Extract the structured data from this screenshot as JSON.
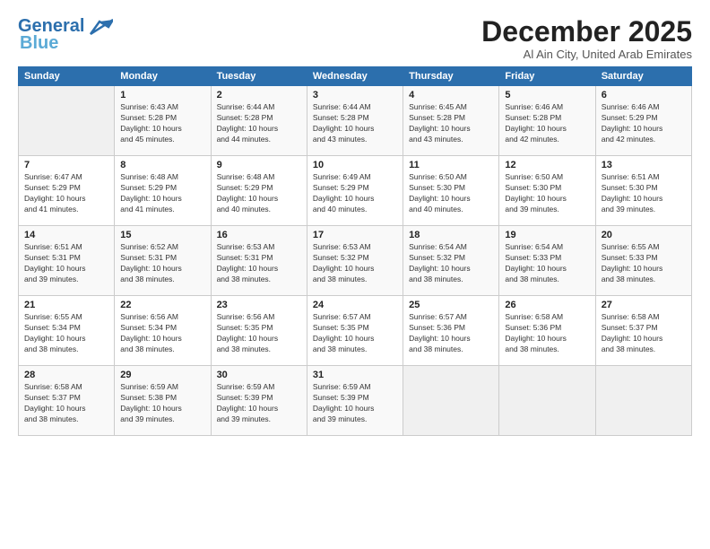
{
  "logo": {
    "line1": "General",
    "line2": "Blue"
  },
  "header": {
    "month": "December 2025",
    "location": "Al Ain City, United Arab Emirates"
  },
  "weekdays": [
    "Sunday",
    "Monday",
    "Tuesday",
    "Wednesday",
    "Thursday",
    "Friday",
    "Saturday"
  ],
  "weeks": [
    [
      {
        "day": "",
        "info": ""
      },
      {
        "day": "1",
        "info": "Sunrise: 6:43 AM\nSunset: 5:28 PM\nDaylight: 10 hours\nand 45 minutes."
      },
      {
        "day": "2",
        "info": "Sunrise: 6:44 AM\nSunset: 5:28 PM\nDaylight: 10 hours\nand 44 minutes."
      },
      {
        "day": "3",
        "info": "Sunrise: 6:44 AM\nSunset: 5:28 PM\nDaylight: 10 hours\nand 43 minutes."
      },
      {
        "day": "4",
        "info": "Sunrise: 6:45 AM\nSunset: 5:28 PM\nDaylight: 10 hours\nand 43 minutes."
      },
      {
        "day": "5",
        "info": "Sunrise: 6:46 AM\nSunset: 5:28 PM\nDaylight: 10 hours\nand 42 minutes."
      },
      {
        "day": "6",
        "info": "Sunrise: 6:46 AM\nSunset: 5:29 PM\nDaylight: 10 hours\nand 42 minutes."
      }
    ],
    [
      {
        "day": "7",
        "info": "Sunrise: 6:47 AM\nSunset: 5:29 PM\nDaylight: 10 hours\nand 41 minutes."
      },
      {
        "day": "8",
        "info": "Sunrise: 6:48 AM\nSunset: 5:29 PM\nDaylight: 10 hours\nand 41 minutes."
      },
      {
        "day": "9",
        "info": "Sunrise: 6:48 AM\nSunset: 5:29 PM\nDaylight: 10 hours\nand 40 minutes."
      },
      {
        "day": "10",
        "info": "Sunrise: 6:49 AM\nSunset: 5:29 PM\nDaylight: 10 hours\nand 40 minutes."
      },
      {
        "day": "11",
        "info": "Sunrise: 6:50 AM\nSunset: 5:30 PM\nDaylight: 10 hours\nand 40 minutes."
      },
      {
        "day": "12",
        "info": "Sunrise: 6:50 AM\nSunset: 5:30 PM\nDaylight: 10 hours\nand 39 minutes."
      },
      {
        "day": "13",
        "info": "Sunrise: 6:51 AM\nSunset: 5:30 PM\nDaylight: 10 hours\nand 39 minutes."
      }
    ],
    [
      {
        "day": "14",
        "info": "Sunrise: 6:51 AM\nSunset: 5:31 PM\nDaylight: 10 hours\nand 39 minutes."
      },
      {
        "day": "15",
        "info": "Sunrise: 6:52 AM\nSunset: 5:31 PM\nDaylight: 10 hours\nand 38 minutes."
      },
      {
        "day": "16",
        "info": "Sunrise: 6:53 AM\nSunset: 5:31 PM\nDaylight: 10 hours\nand 38 minutes."
      },
      {
        "day": "17",
        "info": "Sunrise: 6:53 AM\nSunset: 5:32 PM\nDaylight: 10 hours\nand 38 minutes."
      },
      {
        "day": "18",
        "info": "Sunrise: 6:54 AM\nSunset: 5:32 PM\nDaylight: 10 hours\nand 38 minutes."
      },
      {
        "day": "19",
        "info": "Sunrise: 6:54 AM\nSunset: 5:33 PM\nDaylight: 10 hours\nand 38 minutes."
      },
      {
        "day": "20",
        "info": "Sunrise: 6:55 AM\nSunset: 5:33 PM\nDaylight: 10 hours\nand 38 minutes."
      }
    ],
    [
      {
        "day": "21",
        "info": "Sunrise: 6:55 AM\nSunset: 5:34 PM\nDaylight: 10 hours\nand 38 minutes."
      },
      {
        "day": "22",
        "info": "Sunrise: 6:56 AM\nSunset: 5:34 PM\nDaylight: 10 hours\nand 38 minutes."
      },
      {
        "day": "23",
        "info": "Sunrise: 6:56 AM\nSunset: 5:35 PM\nDaylight: 10 hours\nand 38 minutes."
      },
      {
        "day": "24",
        "info": "Sunrise: 6:57 AM\nSunset: 5:35 PM\nDaylight: 10 hours\nand 38 minutes."
      },
      {
        "day": "25",
        "info": "Sunrise: 6:57 AM\nSunset: 5:36 PM\nDaylight: 10 hours\nand 38 minutes."
      },
      {
        "day": "26",
        "info": "Sunrise: 6:58 AM\nSunset: 5:36 PM\nDaylight: 10 hours\nand 38 minutes."
      },
      {
        "day": "27",
        "info": "Sunrise: 6:58 AM\nSunset: 5:37 PM\nDaylight: 10 hours\nand 38 minutes."
      }
    ],
    [
      {
        "day": "28",
        "info": "Sunrise: 6:58 AM\nSunset: 5:37 PM\nDaylight: 10 hours\nand 38 minutes."
      },
      {
        "day": "29",
        "info": "Sunrise: 6:59 AM\nSunset: 5:38 PM\nDaylight: 10 hours\nand 39 minutes."
      },
      {
        "day": "30",
        "info": "Sunrise: 6:59 AM\nSunset: 5:39 PM\nDaylight: 10 hours\nand 39 minutes."
      },
      {
        "day": "31",
        "info": "Sunrise: 6:59 AM\nSunset: 5:39 PM\nDaylight: 10 hours\nand 39 minutes."
      },
      {
        "day": "",
        "info": ""
      },
      {
        "day": "",
        "info": ""
      },
      {
        "day": "",
        "info": ""
      }
    ]
  ]
}
